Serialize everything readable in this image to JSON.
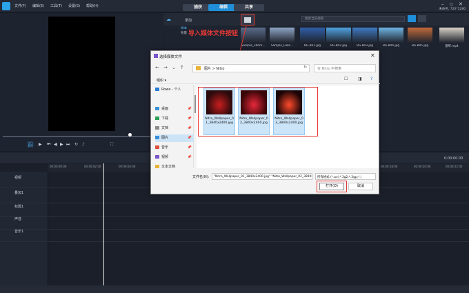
{
  "app": {
    "menu": [
      "文件(F)",
      "编辑(E)",
      "工具(T)",
      "设置(S)",
      "帮助(H)"
    ],
    "tabs": [
      "捕获",
      "编辑",
      "共享"
    ],
    "active_tab": "编辑",
    "project_info": "未命名, 720*1280"
  },
  "preview": {
    "project_label": "项目-",
    "clip_label": "素材-"
  },
  "library": {
    "add_label": "添加",
    "search_placeholder": "搜索当前视图",
    "sidebar_items": [
      "样本",
      "背景"
    ],
    "thumbnails": [
      {
        "label": "Sample_360m...",
        "color": "#5a6b8a"
      },
      {
        "label": "Sample_Lake...",
        "color": "#8fa6c4"
      },
      {
        "label": "BG-B01.jpg",
        "color": "#2f5fa8"
      },
      {
        "label": "BG-B02.jpg",
        "color": "#4fa3e0"
      },
      {
        "label": "BG-B03.jpg",
        "color": "#3f7ac2"
      },
      {
        "label": "BG-B04.jpg",
        "color": "#6fb5e4"
      },
      {
        "label": "BG-B05.jpg",
        "color": "#c26a3a"
      },
      {
        "label": "钢琴.mp4",
        "color": "#d9d2c6"
      }
    ],
    "annotation": "导入媒体文件按钮"
  },
  "timeline": {
    "tracks": [
      "视频",
      "叠加1",
      "标题1",
      "声音",
      "音乐1"
    ],
    "timecodes": [
      "00:00:00:00",
      "00:00:02:00",
      "00:00:04:00",
      "00:00:18:00",
      "00:00:20:00",
      "00:00:22:00"
    ],
    "time_display": "0:00:00.00"
  },
  "dialog": {
    "title": "选择媒体文件",
    "path": [
      "图片",
      "Nitro"
    ],
    "search_placeholder": "在 Nitro 中搜索",
    "organize": "组织 ▾",
    "nav_items": [
      {
        "label": "Rowe - 个人",
        "color": "#2b7cd3",
        "pinned": false
      },
      {
        "label": "桌面",
        "color": "#3b8fd9",
        "pinned": true
      },
      {
        "label": "下载",
        "color": "#2aa05a",
        "pinned": true
      },
      {
        "label": "文档",
        "color": "#8a8a8a",
        "pinned": true
      },
      {
        "label": "图片",
        "color": "#3b8fd9",
        "pinned": true
      },
      {
        "label": "音乐",
        "color": "#e0503a",
        "pinned": true
      },
      {
        "label": "视频",
        "color": "#7a55c8",
        "pinned": true
      },
      {
        "label": "文本文档",
        "color": "#e8b33a",
        "pinned": false
      }
    ],
    "files": [
      {
        "name": "Nitro_Wallpaper_01_3840x2400.jpg",
        "color1": "#2a0a0c",
        "color2": "#c81e1e"
      },
      {
        "name": "Nitro_Wallpaper_02_3840x2400.jpg",
        "color1": "#3a0608",
        "color2": "#e8283a"
      },
      {
        "name": "Nitro_Wallpaper_03_3840x2400.jpg",
        "color1": "#1a0406",
        "color2": "#ff4a2a"
      }
    ],
    "filename_label": "文件名(N):",
    "filename_value": "\"Nitro_Wallpaper_01_3840x2400.jpg\" \"Nitro_Wallpaper_02_3840x2400.jpg\"",
    "filetype_value": "所有格式 (*.avi;*.3g2;*.3gp;*.i",
    "open_label": "打开(O)",
    "cancel_label": "取消"
  }
}
